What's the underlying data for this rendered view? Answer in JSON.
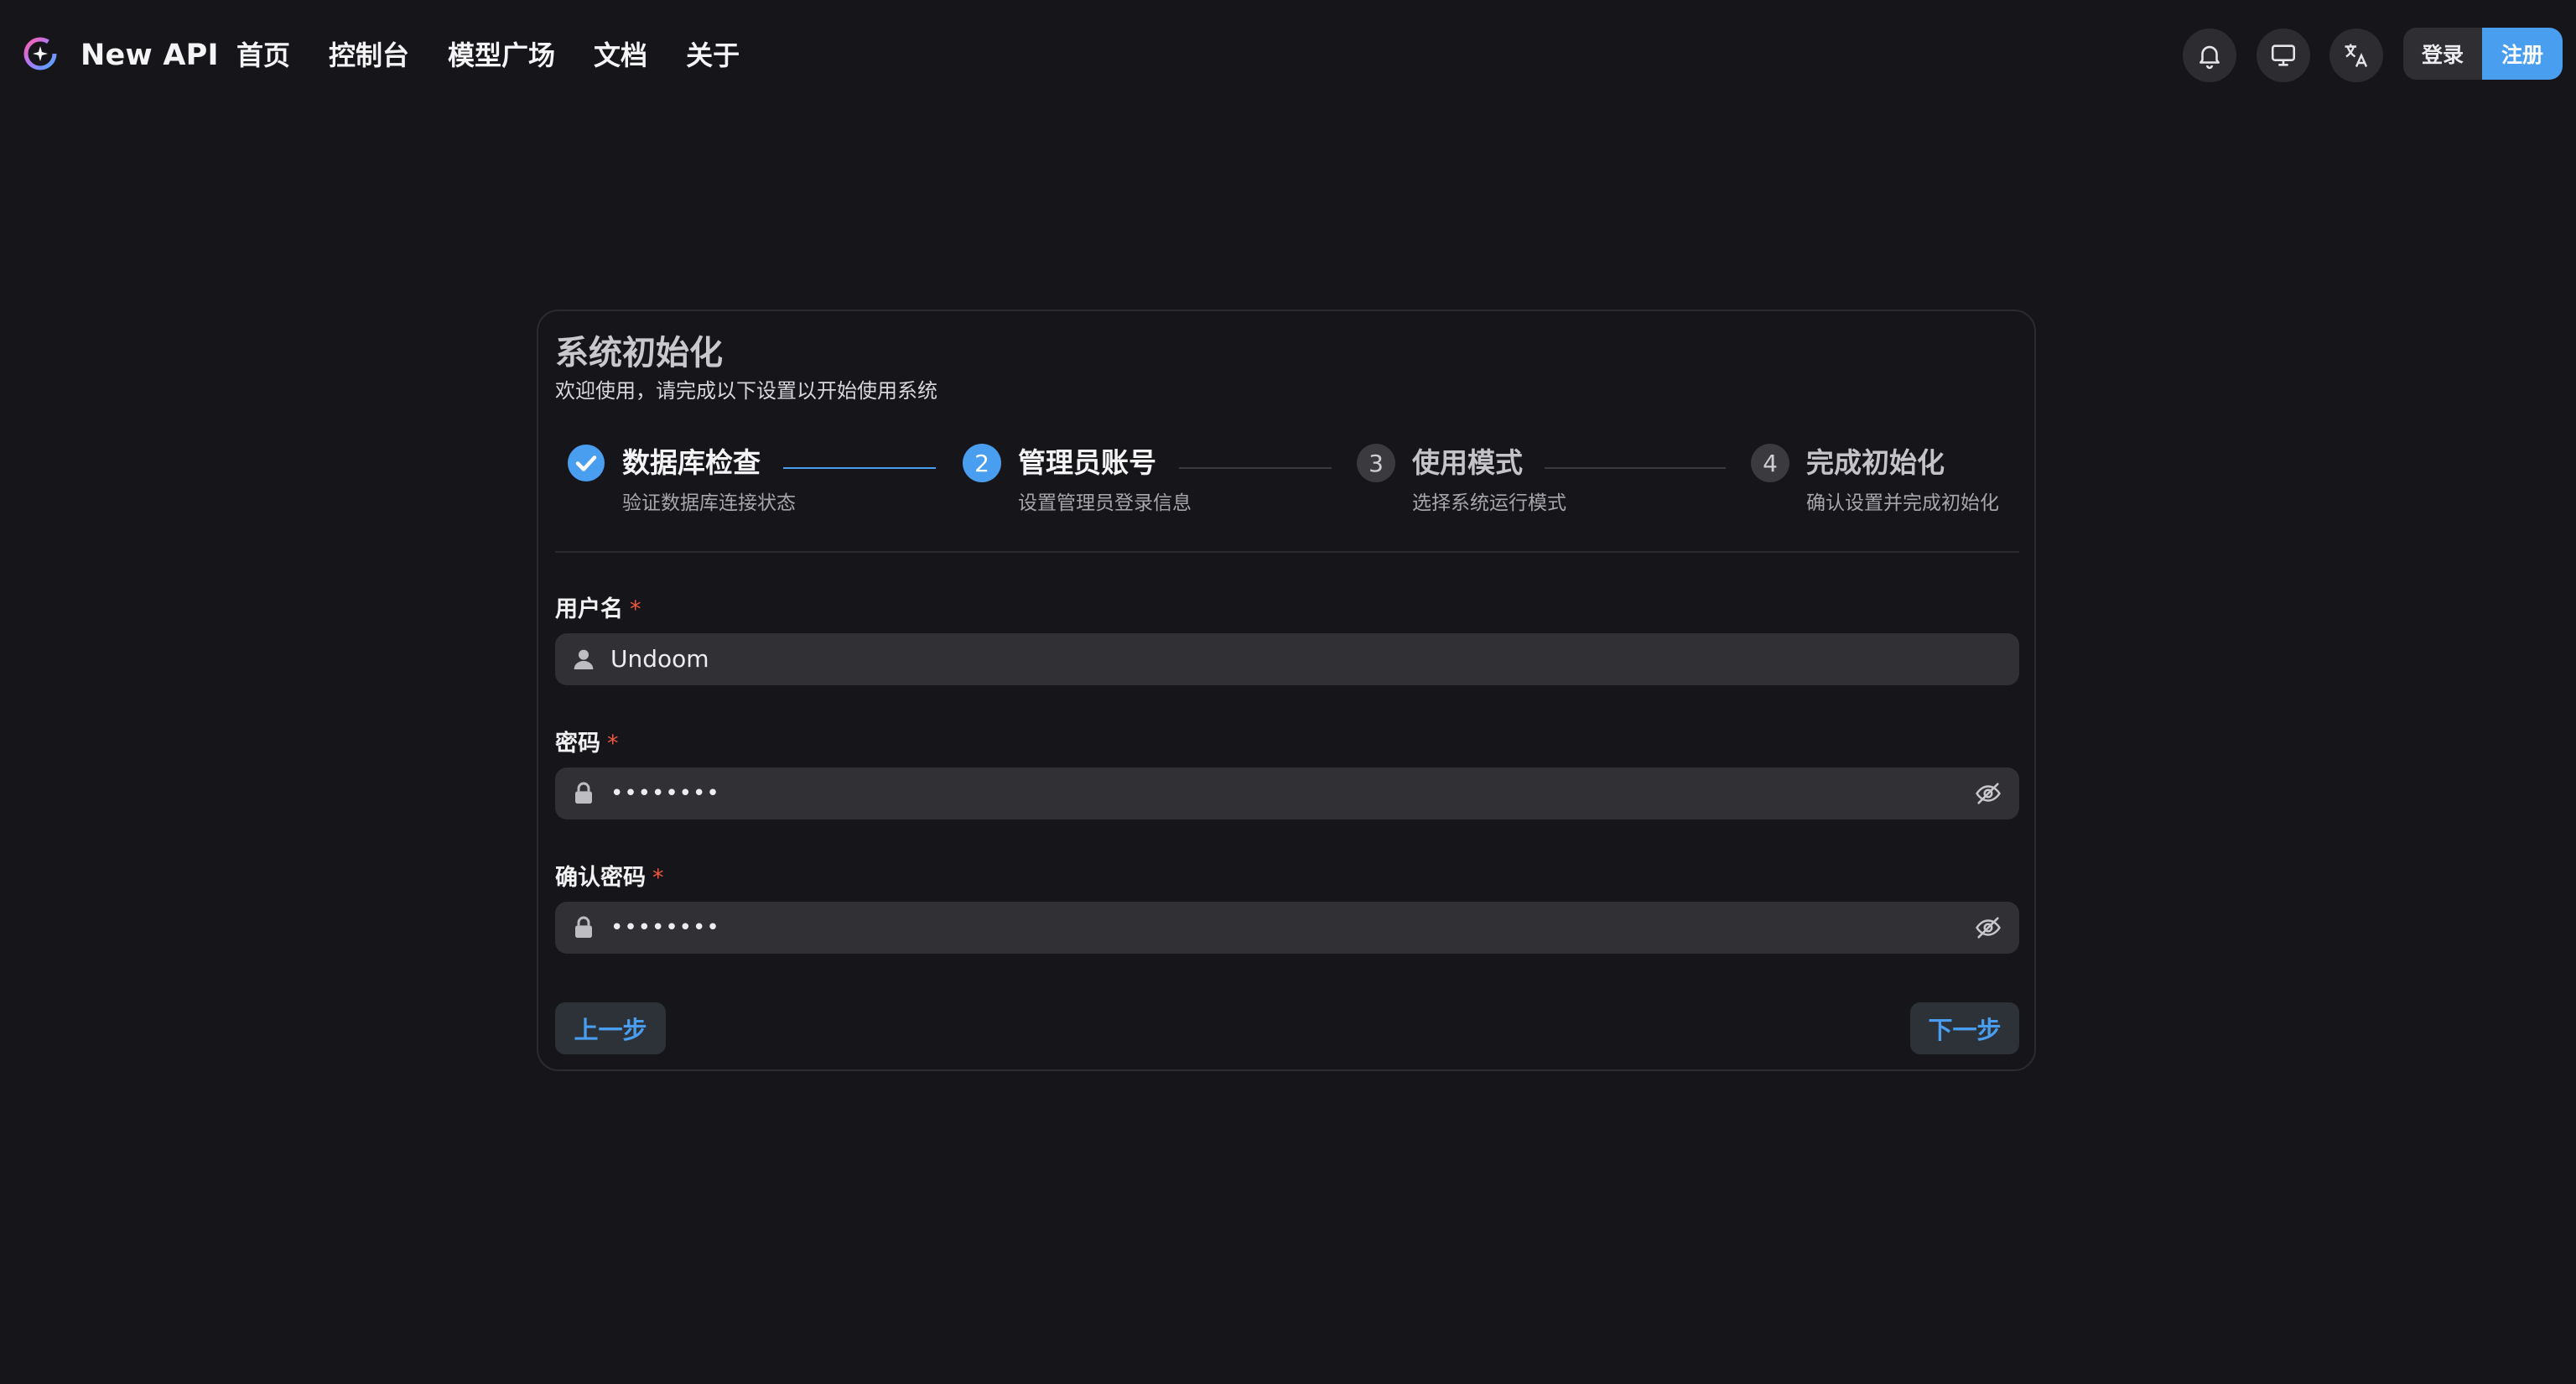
{
  "header": {
    "brand": "New API",
    "nav": [
      "首页",
      "控制台",
      "模型广场",
      "文档",
      "关于"
    ],
    "icons": [
      "bell-icon",
      "monitor-icon",
      "translate-icon"
    ],
    "login_label": "登录",
    "register_label": "注册"
  },
  "card": {
    "title": "系统初始化",
    "subtitle": "欢迎使用，请完成以下设置以开始使用系统"
  },
  "steps": [
    {
      "number": "1",
      "title": "数据库检查",
      "desc": "验证数据库连接状态",
      "status": "done"
    },
    {
      "number": "2",
      "title": "管理员账号",
      "desc": "设置管理员登录信息",
      "status": "active"
    },
    {
      "number": "3",
      "title": "使用模式",
      "desc": "选择系统运行模式",
      "status": "pending"
    },
    {
      "number": "4",
      "title": "完成初始化",
      "desc": "确认设置并完成初始化",
      "status": "pending"
    }
  ],
  "form": {
    "required_mark": "*",
    "username": {
      "label": "用户名",
      "value": "Undoom",
      "icon": "user-icon"
    },
    "password": {
      "label": "密码",
      "value": "••••••••",
      "icon": "lock-icon",
      "toggle_icon": "eye-off-icon"
    },
    "confirm_password": {
      "label": "确认密码",
      "value": "••••••••",
      "icon": "lock-icon",
      "toggle_icon": "eye-off-icon"
    }
  },
  "actions": {
    "prev_label": "上一步",
    "next_label": "下一步"
  },
  "colors": {
    "background": "#16161a",
    "accent": "#4a9ef0",
    "input_bg": "#313135",
    "required": "#f0563e"
  }
}
